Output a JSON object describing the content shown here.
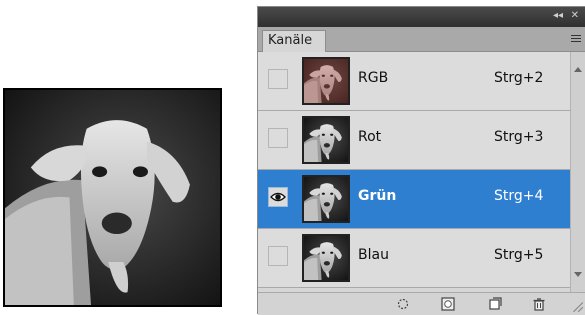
{
  "panel": {
    "tab_label": "Kanäle",
    "title_controls": {
      "collapse": "◂◂",
      "close": "✕"
    },
    "channels": [
      {
        "name": "RGB",
        "shortcut": "Strg+2",
        "visible": false,
        "selected": false,
        "tint": "color"
      },
      {
        "name": "Rot",
        "shortcut": "Strg+3",
        "visible": false,
        "selected": false,
        "tint": "gray"
      },
      {
        "name": "Grün",
        "shortcut": "Strg+4",
        "visible": true,
        "selected": true,
        "tint": "gray"
      },
      {
        "name": "Blau",
        "shortcut": "Strg+5",
        "visible": false,
        "selected": false,
        "tint": "gray"
      }
    ],
    "footer_buttons": [
      "load-selection-icon",
      "save-selection-icon",
      "new-channel-icon",
      "delete-channel-icon"
    ],
    "selection_color": "#2f7fd1"
  },
  "preview": {
    "subject": "goat-photo-grayscale"
  }
}
